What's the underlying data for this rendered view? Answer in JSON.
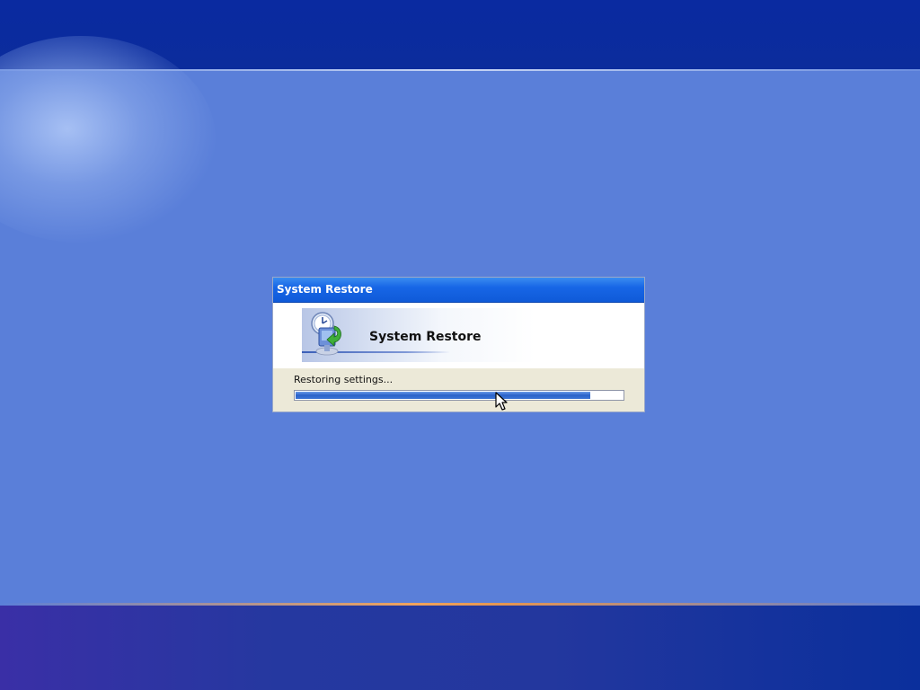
{
  "dialog": {
    "title": "System Restore",
    "header_title": "System Restore",
    "status_text": "Restoring settings...",
    "progress": 0.9
  },
  "icons": {
    "header": "system-restore-icon",
    "cursor": "mouse-cursor-icon"
  },
  "colors": {
    "desktop": "#5a7fd9",
    "titlebar": "#1766e6",
    "dialog_body": "#ece9d8",
    "progress_fill": "#2a62c9"
  }
}
